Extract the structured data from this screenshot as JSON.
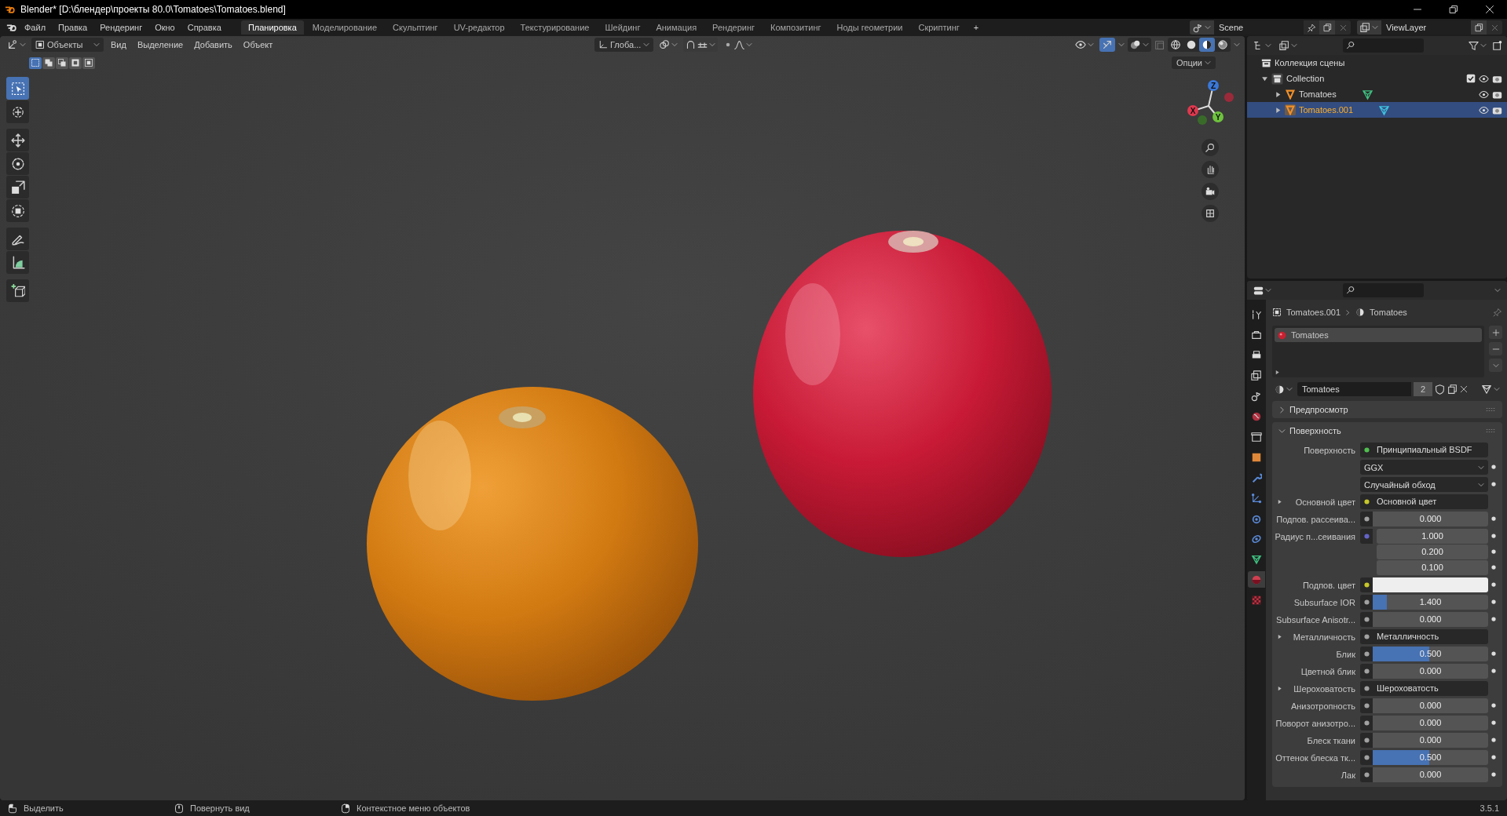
{
  "window": {
    "title": "Blender* [D:\\блендер\\проекты 80.0\\Tomatoes\\Tomatoes.blend]"
  },
  "menu": [
    "Файл",
    "Правка",
    "Рендеринг",
    "Окно",
    "Справка"
  ],
  "workspaces": [
    {
      "label": "Планировка",
      "selected": true
    },
    {
      "label": "Моделирование",
      "selected": false
    },
    {
      "label": "Скульптинг",
      "selected": false
    },
    {
      "label": "UV-редактор",
      "selected": false
    },
    {
      "label": "Текстурирование",
      "selected": false
    },
    {
      "label": "Шейдинг",
      "selected": false
    },
    {
      "label": "Анимация",
      "selected": false
    },
    {
      "label": "Рендеринг",
      "selected": false
    },
    {
      "label": "Композитинг",
      "selected": false
    },
    {
      "label": "Ноды геометрии",
      "selected": false
    },
    {
      "label": "Скриптинг",
      "selected": false
    }
  ],
  "add_workspace": "+",
  "scene": "Scene",
  "view_layer": "ViewLayer",
  "viewport": {
    "mode": "Объекты",
    "menu": [
      "Вид",
      "Выделение",
      "Добавить",
      "Объект"
    ],
    "orientation": "Глоба...",
    "options": "Опции",
    "select_modes": [
      {
        "selected": true
      },
      {
        "selected": false
      },
      {
        "selected": false
      },
      {
        "selected": false
      },
      {
        "selected": false
      }
    ],
    "shading": [
      {
        "selected": false
      },
      {
        "selected": false
      },
      {
        "selected": true
      },
      {
        "selected": false
      }
    ],
    "tools": [
      {
        "kind": "select",
        "selected": true
      },
      {
        "kind": "cursor",
        "selected": false
      },
      {
        "kind": "move",
        "selected": false
      },
      {
        "kind": "rotate",
        "selected": false
      },
      {
        "kind": "scale",
        "selected": false
      },
      {
        "kind": "transform",
        "selected": false
      },
      {
        "kind": "annotate",
        "selected": false
      },
      {
        "kind": "measure",
        "selected": false
      },
      {
        "kind": "add_cube",
        "selected": false
      }
    ],
    "gizmo": [
      "X",
      "Y",
      "Z"
    ]
  },
  "outliner": {
    "root": "Коллекция сцены",
    "items": [
      {
        "name": "Collection",
        "kind": "collection",
        "expanded": true,
        "selected": false,
        "checked": true,
        "children": [
          {
            "name": "Tomatoes",
            "kind": "mesh",
            "expanded": false,
            "selected": false
          },
          {
            "name": "Tomatoes.001",
            "kind": "mesh",
            "expanded": false,
            "selected": true
          }
        ]
      }
    ]
  },
  "properties": {
    "tabs": [
      {
        "kind": "tool",
        "selected": false
      },
      {
        "kind": "render",
        "selected": false
      },
      {
        "kind": "output",
        "selected": false
      },
      {
        "kind": "view_layer",
        "selected": false
      },
      {
        "kind": "scene",
        "selected": false
      },
      {
        "kind": "world",
        "selected": false
      },
      {
        "kind": "collection",
        "selected": false
      },
      {
        "kind": "object",
        "selected": false
      },
      {
        "kind": "modifier",
        "selected": false
      },
      {
        "kind": "particles",
        "selected": false
      },
      {
        "kind": "physics",
        "selected": false
      },
      {
        "kind": "constraints",
        "selected": false
      },
      {
        "kind": "data",
        "selected": false
      },
      {
        "kind": "material",
        "selected": true
      },
      {
        "kind": "texture",
        "selected": false
      }
    ],
    "breadcrumb": [
      "Tomatoes.001",
      "Tomatoes"
    ],
    "slots": [
      {
        "name": "Tomatoes",
        "selected": true
      }
    ],
    "material": {
      "name": "Tomatoes",
      "users": "2"
    },
    "panels": [
      {
        "title": "Предпросмотр",
        "expanded": false
      },
      {
        "title": "Поверхность",
        "expanded": true,
        "rows": [
          {
            "kind": "link",
            "label": "Поверхность",
            "value": "Принципиальный BSDF",
            "color": "#4fbf4f"
          },
          {
            "kind": "dropdown",
            "value": "GGX"
          },
          {
            "kind": "dropdown",
            "value": "Случайный обход"
          },
          {
            "kind": "link",
            "label": "Основной цвет",
            "value": "Основной цвет",
            "color": "#c7c729",
            "expanded": false
          },
          {
            "kind": "value",
            "label": "Подпов. рассеива...",
            "value": "0.000",
            "level": 0,
            "color": "#a1a1a1"
          },
          {
            "kind": "vector",
            "label": "Радиус п...сеивания",
            "values": [
              "1.000",
              "0.200",
              "0.100"
            ],
            "color": "#6363c7"
          },
          {
            "kind": "color",
            "label": "Подпов. цвет",
            "swatch": {
              "color": "#eeeeee"
            },
            "color": "#c7c729"
          },
          {
            "kind": "value",
            "label": "Subsurface IOR",
            "value": "1.400",
            "level": 0.12,
            "color": "#a1a1a1"
          },
          {
            "kind": "value",
            "label": "Subsurface Anisotr...",
            "value": "0.000",
            "level": 0,
            "color": "#a1a1a1"
          },
          {
            "kind": "link",
            "label": "Металличность",
            "value": "Металличность",
            "color": "#a1a1a1",
            "expanded": false
          },
          {
            "kind": "value",
            "label": "Блик",
            "value": "0.500",
            "level": 0.49,
            "color": "#a1a1a1"
          },
          {
            "kind": "value",
            "label": "Цветной блик",
            "value": "0.000",
            "level": 0,
            "color": "#a1a1a1"
          },
          {
            "kind": "link",
            "label": "Шероховатость",
            "value": "Шероховатость",
            "color": "#a1a1a1",
            "expanded": false
          },
          {
            "kind": "value",
            "label": "Анизотропность",
            "value": "0.000",
            "level": 0,
            "color": "#a1a1a1"
          },
          {
            "kind": "value",
            "label": "Поворот анизотро...",
            "value": "0.000",
            "level": 0,
            "color": "#a1a1a1"
          },
          {
            "kind": "value",
            "label": "Блеск ткани",
            "value": "0.000",
            "level": 0,
            "color": "#a1a1a1"
          },
          {
            "kind": "value",
            "label": "Оттенок блеска тк...",
            "value": "0.500",
            "level": 0.49,
            "color": "#a1a1a1"
          },
          {
            "kind": "value",
            "label": "Лак",
            "value": "0.000",
            "level": 0,
            "color": "#a1a1a1"
          }
        ]
      }
    ]
  },
  "status": {
    "hints": [
      {
        "kind": "left",
        "label": "Выделить"
      },
      {
        "kind": "middle",
        "label": "Повернуть вид"
      },
      {
        "kind": "right",
        "label": "Контекстное меню объектов"
      }
    ],
    "version": "3.5.1"
  }
}
